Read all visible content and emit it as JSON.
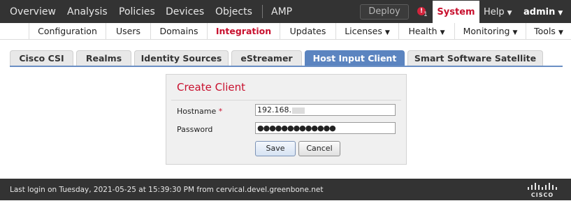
{
  "topnav": {
    "items": [
      "Overview",
      "Analysis",
      "Policies",
      "Devices",
      "Objects",
      "AMP"
    ],
    "deploy_label": "Deploy",
    "alert_count": "1",
    "system_label": "System",
    "help_label": "Help",
    "user_label": "admin"
  },
  "subnav": {
    "items": [
      "Configuration",
      "Users",
      "Domains",
      "Integration",
      "Updates",
      "Licenses",
      "Health",
      "Monitoring",
      "Tools"
    ],
    "active": "Integration"
  },
  "tabs": {
    "items": [
      "Cisco CSI",
      "Realms",
      "Identity Sources",
      "eStreamer",
      "Host Input Client",
      "Smart Software Satellite"
    ],
    "active": "Host Input Client"
  },
  "form": {
    "title": "Create Client",
    "hostname_label": "Hostname",
    "required_mark": "*",
    "hostname_value": "192.168.",
    "password_label": "Password",
    "password_value": "●●●●●●●●●●●●●",
    "save_label": "Save",
    "cancel_label": "Cancel"
  },
  "footer": {
    "last_login": "Last login on Tuesday, 2021-05-25 at 15:39:30 PM from cervical.devel.greenbone.net",
    "logo_label": "CISCO"
  },
  "colors": {
    "accent_red": "#c8102e",
    "tab_active_blue": "#5b84c0",
    "bar_dark": "#333333"
  }
}
